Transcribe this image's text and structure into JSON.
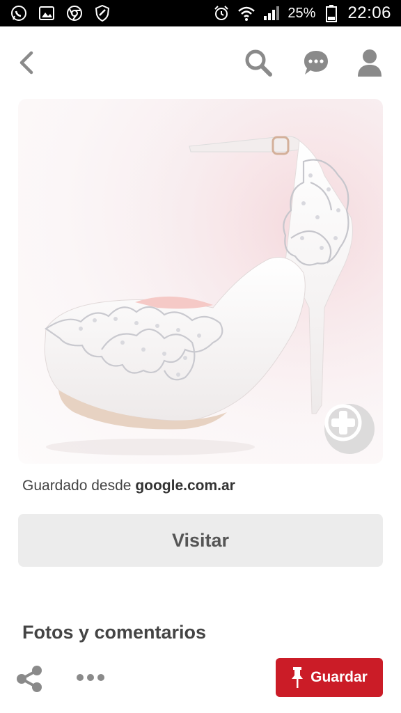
{
  "status_bar": {
    "icons_left": [
      "whatsapp-icon",
      "gallery-icon",
      "chrome-icon",
      "shield-icon"
    ],
    "icons_right": [
      "alarm-icon",
      "wifi-icon",
      "signal-icon",
      "battery-icon"
    ],
    "battery": "25%",
    "time": "22:06"
  },
  "nav": {
    "back": "back-icon",
    "search": "search-icon",
    "messages": "chat-icon",
    "profile": "profile-icon"
  },
  "pin": {
    "image_description_icon": "zoom-plus-icon",
    "saved_from_prefix": "Guardado desde",
    "saved_from_domain": "google.com.ar",
    "visit_label": "Visitar",
    "section_title": "Fotos y comentarios"
  },
  "bottom_bar": {
    "share": "share-icon",
    "more": "more-icon",
    "save_label": "Guardar",
    "save_icon": "pin-icon"
  },
  "colors": {
    "accent": "#cb1c27",
    "icon_gray": "#8a8a8a",
    "button_bg": "#ececec"
  }
}
